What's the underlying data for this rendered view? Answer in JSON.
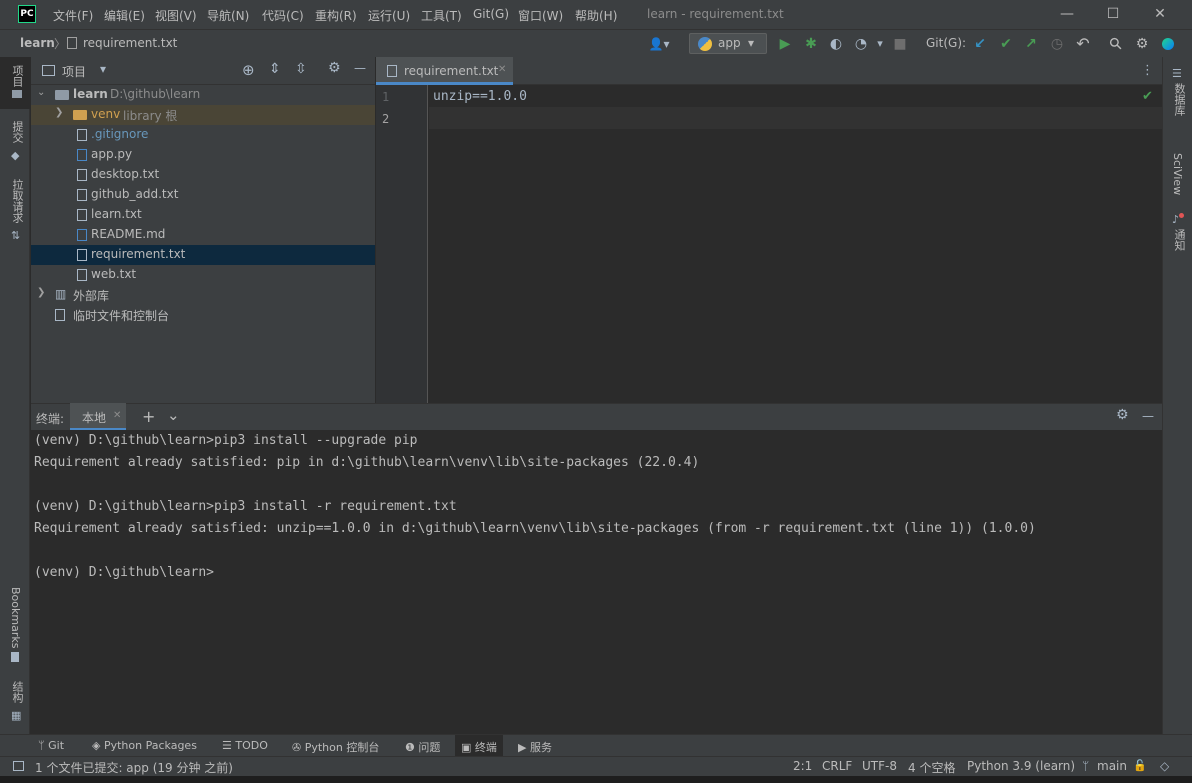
{
  "app": {
    "logo_text": "PC",
    "window_title": "learn - requirement.txt"
  },
  "menu": [
    "文件(F)",
    "编辑(E)",
    "视图(V)",
    "导航(N)",
    "代码(C)",
    "重构(R)",
    "运行(U)",
    "工具(T)",
    "Git(G)",
    "窗口(W)",
    "帮助(H)"
  ],
  "window_controls": {
    "minimize": "—",
    "maximize": "☐",
    "close": "✕"
  },
  "breadcrumb": {
    "project": "learn",
    "separator": "〉",
    "file": "requirement.txt"
  },
  "toolbar": {
    "user_icon": "👤▾",
    "run_config": "app",
    "run_icon": "▶",
    "debug_icon": "✱",
    "coverage_icon": "◐",
    "profile_icon": "◔",
    "more_icon": "▾",
    "stop_icon": "■",
    "git_label": "Git(G):",
    "git_update_icon": "↙",
    "git_commit_icon": "✔",
    "git_push_icon": "↗",
    "git_history_icon": "◷",
    "git_rollback_icon": "↶",
    "search_icon": "⚲",
    "settings_icon": "⚙"
  },
  "left_strip": [
    "项目",
    "提交",
    "拉取请求",
    "Bookmarks",
    "结构"
  ],
  "right_strip": [
    "数据库",
    "SciView",
    "通知"
  ],
  "project_panel": {
    "title": "项目",
    "dropdown_icon": "▾",
    "locate_icon": "⊕",
    "expand_icon": "⇕",
    "collapse_icon": "⇳",
    "settings_icon": "⚙",
    "hide_icon": "—",
    "root": {
      "name": "learn",
      "path": "D:\\github\\learn"
    },
    "items": [
      {
        "name": "venv",
        "extra": "library 根"
      },
      {
        "name": ".gitignore"
      },
      {
        "name": "app.py"
      },
      {
        "name": "desktop.txt"
      },
      {
        "name": "github_add.txt"
      },
      {
        "name": "learn.txt"
      },
      {
        "name": "README.md"
      },
      {
        "name": "requirement.txt"
      },
      {
        "name": "web.txt"
      },
      {
        "name": "外部库"
      },
      {
        "name": "临时文件和控制台"
      }
    ]
  },
  "editor": {
    "tab_label": "requirement.txt",
    "tab_close": "✕",
    "more_icon": "⋮",
    "line_numbers": [
      "1",
      "2"
    ],
    "lines": [
      "unzip==1.0.0",
      ""
    ],
    "inspection_ok": "✔"
  },
  "terminal": {
    "title": "终端:",
    "tab_label": "本地",
    "tab_close": "✕",
    "add_icon": "+",
    "dropdown_icon": "⌄",
    "settings_icon": "⚙",
    "hide_icon": "—",
    "lines": [
      "(venv) D:\\github\\learn>pip3 install --upgrade pip",
      "Requirement already satisfied: pip in d:\\github\\learn\\venv\\lib\\site-packages (22.0.4)",
      "",
      "(venv) D:\\github\\learn>pip3 install -r requirement.txt",
      "Requirement already satisfied: unzip==1.0.0 in d:\\github\\learn\\venv\\lib\\site-packages (from -r requirement.txt (line 1)) (1.0.0)",
      "",
      "(venv) D:\\github\\learn>"
    ]
  },
  "bottom_tools": [
    {
      "icon": "ᛘ",
      "label": "Git"
    },
    {
      "icon": "◈",
      "label": "Python Packages"
    },
    {
      "icon": "☰",
      "label": "TODO"
    },
    {
      "icon": "✇",
      "label": "Python 控制台"
    },
    {
      "icon": "❶",
      "label": "问题"
    },
    {
      "icon": "▣",
      "label": "终端"
    },
    {
      "icon": "▶",
      "label": "服务"
    }
  ],
  "status": {
    "message": "1 个文件已提交: app (19 分钟 之前)",
    "position": "2:1",
    "line_sep": "CRLF",
    "encoding": "UTF-8",
    "indent": "4 个空格",
    "interpreter": "Python 3.9 (learn)",
    "branch": "main",
    "lock_icon": "🔓",
    "notify_icon": "◇"
  },
  "colors": {
    "accent": "#4a88c7",
    "selection": "#0d293e",
    "run_green": "#499c54",
    "folder_yellow": "#d0a050"
  }
}
